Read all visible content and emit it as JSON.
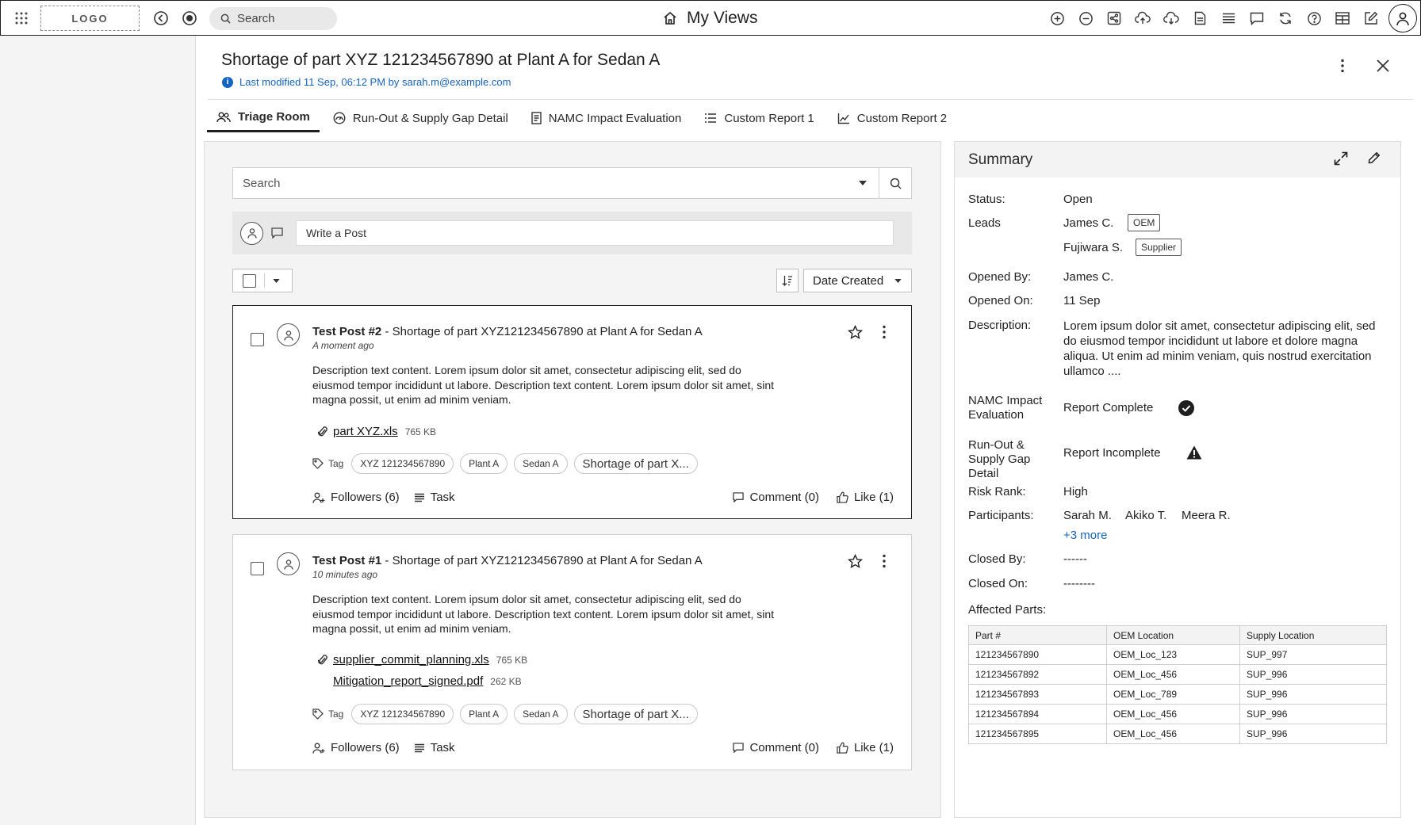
{
  "topbar": {
    "logo": "LOGO",
    "search_placeholder": "Search",
    "title": "My Views"
  },
  "header": {
    "title": "Shortage of part XYZ 121234567890 at Plant A for Sedan A",
    "modified": "Last modified 11 Sep, 06:12 PM by sarah.m@example.com"
  },
  "tabs": [
    {
      "label": "Triage Room",
      "icon": "users-icon"
    },
    {
      "label": "Run-Out & Supply Gap Detail",
      "icon": "gauge-icon"
    },
    {
      "label": "NAMC Impact Evaluation",
      "icon": "document-icon"
    },
    {
      "label": "Custom Report 1",
      "icon": "list-icon"
    },
    {
      "label": "Custom Report 2",
      "icon": "line-chart-icon"
    }
  ],
  "feed": {
    "search_placeholder": "Search",
    "write_placeholder": "Write a Post",
    "sort_label": "Date Created",
    "posts": [
      {
        "title": "Test Post #2",
        "subtitle": " - Shortage of part XYZ121234567890 at Plant A for Sedan A",
        "time": "A moment ago",
        "desc": "Description text content. Lorem ipsum dolor sit amet, consectetur adipiscing elit, sed do eiusmod tempor incididunt ut labore. Description text content. Lorem ipsum dolor sit amet, sint magna possit, ut enim ad minim veniam.",
        "attachments": [
          {
            "name": "part XYZ.xls",
            "size": "765 KB"
          }
        ],
        "tag_label": "Tag",
        "tags": [
          "XYZ 121234567890",
          "Plant A",
          "Sedan A",
          "Shortage of part X..."
        ],
        "followers": "Followers (6)",
        "task": "Task",
        "comment": "Comment (0)",
        "like": "Like (1)"
      },
      {
        "title": "Test Post #1",
        "subtitle": " - Shortage of part XYZ121234567890 at Plant A for Sedan A",
        "time": "10 minutes ago",
        "desc": "Description text content. Lorem ipsum dolor sit amet, consectetur adipiscing elit, sed do eiusmod tempor incididunt ut labore. Description text content. Lorem ipsum dolor sit amet, sint magna possit, ut enim ad minim veniam.",
        "attachments": [
          {
            "name": "supplier_commit_planning.xls",
            "size": "765 KB"
          },
          {
            "name": "Mitigation_report_signed.pdf",
            "size": "262 KB"
          }
        ],
        "tag_label": "Tag",
        "tags": [
          "XYZ 121234567890",
          "Plant A",
          "Sedan A",
          "Shortage of part X..."
        ],
        "followers": "Followers (6)",
        "task": "Task",
        "comment": "Comment (0)",
        "like": "Like (1)"
      }
    ]
  },
  "summary": {
    "title": "Summary",
    "status_label": "Status:",
    "status": "Open",
    "leads_label": "Leads",
    "leads": [
      {
        "name": "James C.",
        "role": "OEM"
      },
      {
        "name": "Fujiwara S.",
        "role": "Supplier"
      }
    ],
    "opened_by_label": "Opened By:",
    "opened_by": "James C.",
    "opened_on_label": "Opened On:",
    "opened_on": "11 Sep",
    "description_label": "Description:",
    "description": "Lorem ipsum dolor sit amet, consectetur adipiscing elit, sed do eiusmod tempor incididunt ut labore et dolore magna aliqua. Ut enim ad minim veniam, quis nostrud exercitation ullamco ....",
    "namc_label": "NAMC Impact Evaluation",
    "namc_value": "Report Complete",
    "runout_label": "Run-Out & Supply Gap Detail",
    "runout_value": "Report Incomplete",
    "risk_label": "Risk Rank:",
    "risk": "High",
    "participants_label": "Participants:",
    "participants": [
      "Sarah M.",
      "Akiko T.",
      "Meera R."
    ],
    "participants_more": "+3 more",
    "closed_by_label": "Closed By:",
    "closed_by": "------",
    "closed_on_label": "Closed On:",
    "closed_on": "--------",
    "affected_label": "Affected Parts:",
    "table": {
      "headers": [
        "Part #",
        "OEM Location",
        "Supply Location"
      ],
      "rows": [
        [
          "121234567890",
          "OEM_Loc_123",
          "SUP_997"
        ],
        [
          "121234567892",
          "OEM_Loc_456",
          "SUP_996"
        ],
        [
          "121234567893",
          "OEM_Loc_789",
          "SUP_996"
        ],
        [
          "121234567894",
          "OEM_Loc_456",
          "SUP_996"
        ],
        [
          "121234567895",
          "OEM_Loc_456",
          "SUP_996"
        ]
      ]
    }
  }
}
